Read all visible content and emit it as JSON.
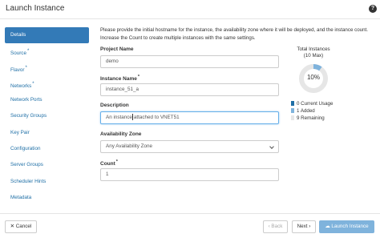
{
  "dialog": {
    "title": "Launch Instance",
    "help_icon": "?"
  },
  "sidebar": {
    "items": [
      {
        "label": "Details",
        "active": true,
        "required": false
      },
      {
        "label": "Source",
        "required": true
      },
      {
        "label": "Flavor",
        "required": true
      },
      {
        "label": "Networks",
        "required": true
      },
      {
        "label": "Network Ports",
        "required": false
      },
      {
        "label": "Security Groups",
        "required": false
      },
      {
        "label": "Key Pair",
        "required": false
      },
      {
        "label": "Configuration",
        "required": false
      },
      {
        "label": "Server Groups",
        "required": false
      },
      {
        "label": "Scheduler Hints",
        "required": false
      },
      {
        "label": "Metadata",
        "required": false
      }
    ],
    "required_marker": "*"
  },
  "form": {
    "description_text": "Please provide the initial hostname for the instance, the availability zone where it will be deployed, and the instance count. Increase the Count to create multiple instances with the same settings.",
    "project_name_label": "Project Name",
    "project_name_value": "demo",
    "instance_name_label": "Instance Name",
    "instance_name_required": "*",
    "instance_name_value": "instance_51_a",
    "description_label": "Description",
    "description_value_before": "An instance",
    "description_value_after": "attached to VNET51",
    "availability_zone_label": "Availability Zone",
    "availability_zone_value": "Any Availability Zone",
    "count_label": "Count",
    "count_required": "*",
    "count_value": "1"
  },
  "quota": {
    "title": "Total Instances",
    "subtitle": "(10 Max)",
    "percent_label": "10%",
    "current_usage_fraction": 0.0,
    "added_fraction": 0.1,
    "legend": [
      {
        "label": "0  Current Usage",
        "color": "#1f6fa6"
      },
      {
        "label": "1  Added",
        "color": "#7fb3dc"
      },
      {
        "label": "9  Remaining",
        "color": "#e6e6e6"
      }
    ]
  },
  "footer": {
    "cancel_label": "Cancel",
    "cancel_icon": "close-icon",
    "back_label": "Back",
    "next_label": "Next",
    "launch_label": "Launch Instance",
    "launch_icon": "cloud-upload-icon"
  },
  "colors": {
    "accent": "#337ab7",
    "link": "#1f6fa6",
    "added": "#7fb3dc",
    "remaining": "#e6e6e6"
  }
}
